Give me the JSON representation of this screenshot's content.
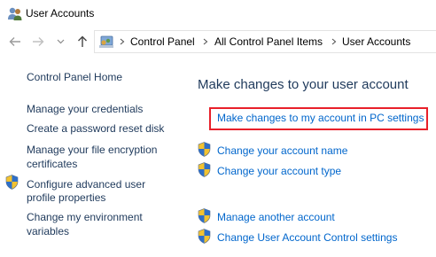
{
  "window": {
    "title": "User Accounts",
    "icon": "user-accounts-icon"
  },
  "navigation": {
    "back_icon": "arrow-left-icon",
    "forward_icon": "arrow-right-icon",
    "recent_icon": "chevron-down-icon",
    "up_icon": "arrow-up-icon"
  },
  "address_bar": {
    "icon": "control-panel-icon",
    "breadcrumbs": [
      "Control Panel",
      "All Control Panel Items",
      "User Accounts"
    ]
  },
  "sidebar": {
    "home": "Control Panel Home",
    "links": [
      "Manage your credentials",
      "Create a password reset disk",
      "Manage your file encryption",
      "certificates",
      "Configure advanced user",
      "profile properties",
      "Change my environment",
      "variables"
    ]
  },
  "main": {
    "heading": "Make changes to your user account",
    "pc_settings_link": "Make changes to my account in PC settings",
    "links": [
      "Change your account name",
      "Change your account type",
      "Manage another account",
      "Change User Account Control settings"
    ]
  },
  "colors": {
    "heading": "#1e395b",
    "link": "#0066cc",
    "highlight": "#e8202a"
  }
}
